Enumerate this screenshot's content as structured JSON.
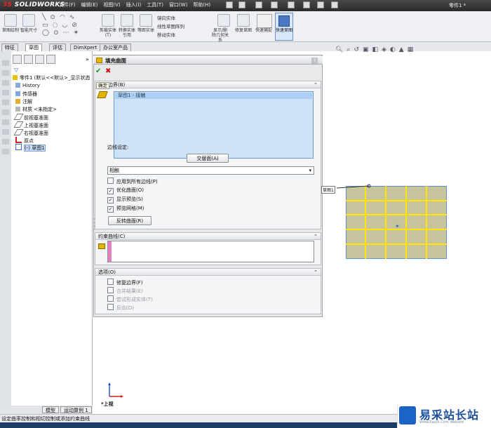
{
  "app": {
    "logo": "SOLIDWORKS",
    "doc_name": "零件1 *"
  },
  "menu": [
    "文件(F)",
    "编辑(E)",
    "视图(V)",
    "插入(I)",
    "工具(T)",
    "窗口(W)",
    "帮助(H)"
  ],
  "toolbar": {
    "items": [
      {
        "label": "草图绘制",
        "icon": "sketch-icon"
      },
      {
        "label": "智能尺寸",
        "icon": "smart-dimension-icon"
      },
      {
        "label": "剪裁实体(T)",
        "icon": "trim-icon"
      },
      {
        "label": "转换实体引用",
        "icon": "convert-entities-icon"
      },
      {
        "label": "等距实体",
        "icon": "offset-icon"
      },
      {
        "label": "显示/删除几何关系",
        "icon": "relations-icon"
      },
      {
        "label": "修复草图",
        "icon": "repair-sketch-icon"
      },
      {
        "label": "快速捕捉",
        "icon": "quick-snap-icon"
      },
      {
        "label": "快速草图",
        "icon": "rapid-sketch-icon"
      }
    ],
    "mirror_label": "镜向实体",
    "linear_pattern_label": "线性草图阵列",
    "move_label": "移动实体"
  },
  "tabs": [
    "特征",
    "草图",
    "评估",
    "DimXpert",
    "办公室产品"
  ],
  "active_tab": "草图",
  "tree": {
    "root": "零件1 (默认<<默认>_显示状态",
    "items": [
      "History",
      "传感器",
      "注解",
      "材质 <未指定>",
      "前视基准面",
      "上视基准面",
      "右视基准面",
      "原点",
      "(-) 草图1"
    ]
  },
  "property_manager": {
    "title": "填充曲面",
    "help": "?",
    "patch_boundary": {
      "header": "修补边界(B)",
      "tooltip": "确定",
      "list_item": "草图1 - 接触",
      "edge_settings_label": "边线设定:",
      "alternate_face_button": "交替面(A)",
      "curvature_control": "相触",
      "apply_all_edges": "应用到所有边线(P)",
      "optimize_surface": "优化曲面(O)",
      "show_preview": "显示预览(S)",
      "preview_mesh": "预览网格(M)",
      "reverse_surface_button": "反转曲面(R)"
    },
    "constraint_curves": {
      "header": "约束曲线(C)"
    },
    "options": {
      "header": "选项(O)",
      "fix_up_boundary": "修复边界(F)",
      "merge_result": "合并结果(E)",
      "try_form_solid": "尝试形成实体(T)",
      "reverse": "反向(D)"
    }
  },
  "graphics": {
    "boundary_tag": "草图1",
    "view_name": "*上视"
  },
  "bottom_tabs": [
    "模型",
    "运动算例 1"
  ],
  "status_text": "设定曲率控制和相切控制或添加约束曲线",
  "watermark": {
    "title": "易采站长站",
    "subtitle": "Www.Easck.Com Website"
  }
}
